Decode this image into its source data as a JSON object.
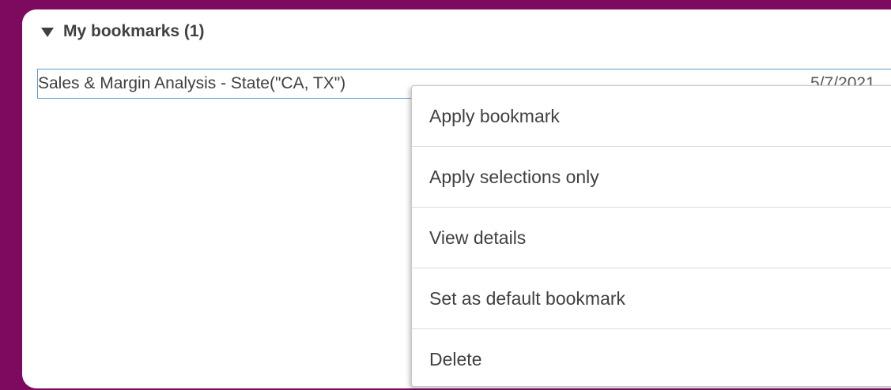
{
  "bookmarks_section": {
    "header": "My bookmarks (1)",
    "items": [
      {
        "name": "Sales & Margin Analysis - State(\"CA, TX\")",
        "date": "5/7/2021"
      }
    ]
  },
  "context_menu": {
    "items": [
      {
        "label": "Apply bookmark"
      },
      {
        "label": "Apply selections only"
      },
      {
        "label": "View details"
      },
      {
        "label": "Set as default bookmark"
      },
      {
        "label": "Delete"
      }
    ]
  },
  "colors": {
    "background": "#7d0a5e",
    "panel": "#ffffff",
    "text": "#404040",
    "selection_border": "#5b9bd5"
  }
}
